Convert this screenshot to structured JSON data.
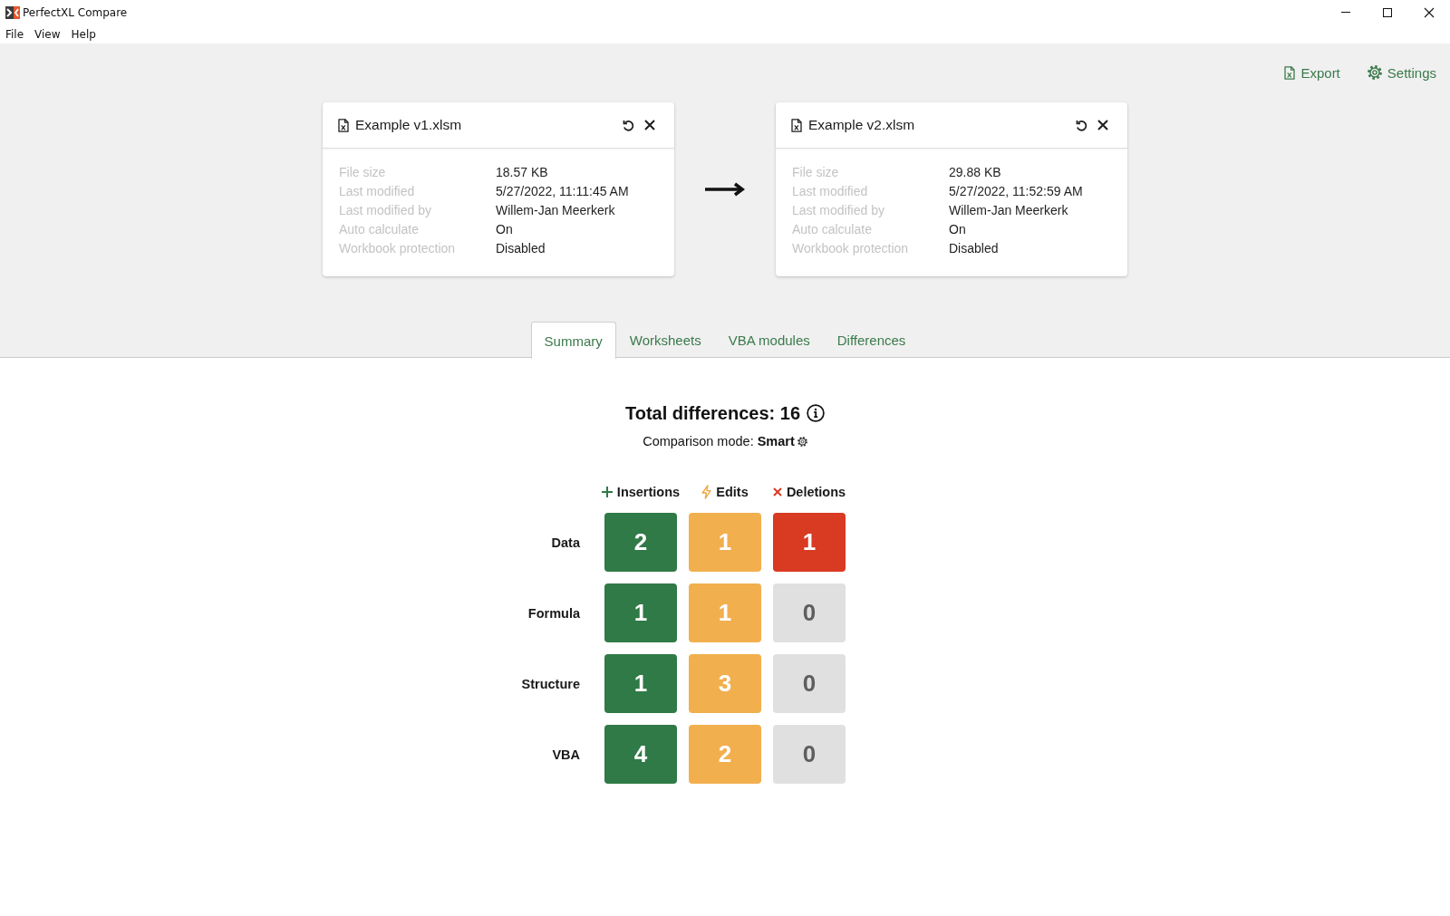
{
  "window": {
    "title": "PerfectXL Compare"
  },
  "menu": [
    "File",
    "View",
    "Help"
  ],
  "toolbar": [
    {
      "kind": "export",
      "label": "Export"
    },
    {
      "kind": "settings",
      "label": "Settings"
    }
  ],
  "files": [
    {
      "name": "Example v1.xlsm",
      "properties": [
        {
          "label": "File size",
          "value": "18.57 KB"
        },
        {
          "label": "Last modified",
          "value": "5/27/2022, 11:11:45 AM"
        },
        {
          "label": "Last modified by",
          "value": "Willem-Jan Meerkerk"
        },
        {
          "label": "Auto calculate",
          "value": "On"
        },
        {
          "label": "Workbook protection",
          "value": "Disabled"
        }
      ]
    },
    {
      "name": "Example v2.xlsm",
      "properties": [
        {
          "label": "File size",
          "value": "29.88 KB"
        },
        {
          "label": "Last modified",
          "value": "5/27/2022, 11:52:59 AM"
        },
        {
          "label": "Last modified by",
          "value": "Willem-Jan Meerkerk"
        },
        {
          "label": "Auto calculate",
          "value": "On"
        },
        {
          "label": "Workbook protection",
          "value": "Disabled"
        }
      ]
    }
  ],
  "tabs": [
    {
      "label": "Summary",
      "selected": true
    },
    {
      "label": "Worksheets",
      "selected": false
    },
    {
      "label": "VBA modules",
      "selected": false
    },
    {
      "label": "Differences",
      "selected": false
    }
  ],
  "summary": {
    "total": "Total differences: 16",
    "mode": "Comparison mode: **Smart**"
  },
  "grid": {
    "columns": [
      {
        "kind": "insertions",
        "label": "Insertions"
      },
      {
        "kind": "edits",
        "label": "Edits"
      },
      {
        "kind": "deletions",
        "label": "Deletions"
      }
    ],
    "rows": [
      {
        "label": "Data",
        "cells": [
          {
            "value": "2",
            "color": "#2f7a46"
          },
          {
            "value": "1",
            "color": "#f2af4e"
          },
          {
            "value": "1",
            "color": "#d83a22"
          }
        ]
      },
      {
        "label": "Formula",
        "cells": [
          {
            "value": "1",
            "color": "#2f7a46"
          },
          {
            "value": "1",
            "color": "#f2af4e"
          },
          {
            "value": "0",
            "color": "#e0e0e0"
          }
        ]
      },
      {
        "label": "Structure",
        "cells": [
          {
            "value": "1",
            "color": "#2f7a46"
          },
          {
            "value": "3",
            "color": "#f2af4e"
          },
          {
            "value": "0",
            "color": "#e0e0e0"
          }
        ]
      },
      {
        "label": "VBA",
        "cells": [
          {
            "value": "4",
            "color": "#2f7a46"
          },
          {
            "value": "2",
            "color": "#f2af4e"
          },
          {
            "value": "0",
            "color": "#e0e0e0"
          }
        ]
      }
    ]
  }
}
